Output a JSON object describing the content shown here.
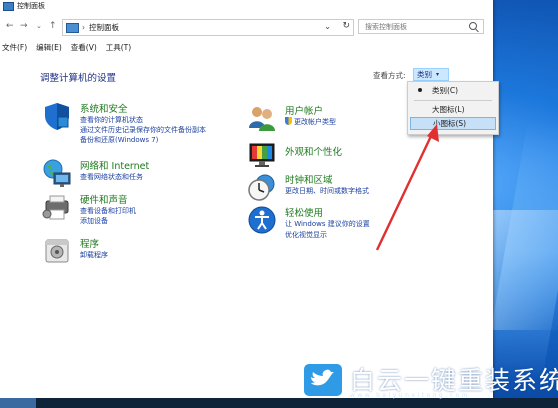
{
  "window": {
    "title": "控制面板"
  },
  "address": {
    "path": "控制面板",
    "separator": "›",
    "dropdown": "⌄",
    "refresh": "↻"
  },
  "nav": {
    "back": "←",
    "forward": "→",
    "history": "⌄",
    "up": "↑"
  },
  "search": {
    "placeholder": "搜索控制面板"
  },
  "menu": [
    "文件(F)",
    "编辑(E)",
    "查看(V)",
    "工具(T)"
  ],
  "page": {
    "title": "调整计算机的设置"
  },
  "view_by": {
    "label": "查看方式:",
    "current": "类别",
    "arrow": "▾"
  },
  "view_options": [
    {
      "label": "类别(C)",
      "checked": true
    },
    {
      "label": "大图标(L)",
      "checked": false
    },
    {
      "label": "小图标(S)",
      "checked": false,
      "highlighted": true
    }
  ],
  "categories_left": [
    {
      "title": "系统和安全",
      "links": [
        "查看你的计算机状态",
        "通过文件历史记录保存你的文件备份副本",
        "备份和还原(Windows 7)"
      ],
      "icon": "shield-icon"
    },
    {
      "title": "网络和 Internet",
      "links": [
        "查看网络状态和任务"
      ],
      "icon": "network-globe-icon"
    },
    {
      "title": "硬件和声音",
      "links": [
        "查看设备和打印机",
        "添加设备"
      ],
      "icon": "printer-icon"
    },
    {
      "title": "程序",
      "links": [
        "卸载程序"
      ],
      "icon": "programs-icon"
    }
  ],
  "categories_right": [
    {
      "title": "用户帐户",
      "links": [
        "更改帐户类型"
      ],
      "icon": "users-icon"
    },
    {
      "title": "外观和个性化",
      "links": [],
      "icon": "appearance-icon"
    },
    {
      "title": "时钟和区域",
      "links": [
        "更改日期、时间或数字格式"
      ],
      "icon": "clock-globe-icon"
    },
    {
      "title": "轻松使用",
      "links": [
        "让 Windows 建议你的设置",
        "优化视觉显示"
      ],
      "icon": "ease-of-access-icon"
    }
  ],
  "watermark": {
    "text": "白云一键重装系统",
    "url": "www.baiyunxitong.com"
  },
  "colors": {
    "category_title": "#1f7a1f",
    "link": "#1a3fa0",
    "heading": "#1e3287",
    "arrow": "#e03030"
  }
}
